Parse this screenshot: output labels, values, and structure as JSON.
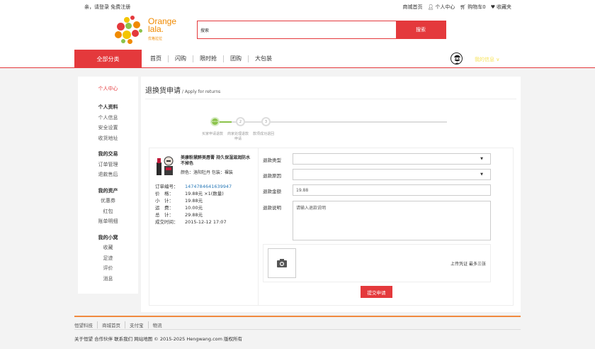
{
  "topbar": {
    "greeting": "亲，请登录 免费注册",
    "links": [
      "商城首页",
      "个人中心",
      "购物车0",
      "收藏夹"
    ]
  },
  "logo": {
    "brand_line1": "Orange",
    "brand_line2": "lala.",
    "sub": "优格拉拉"
  },
  "search": {
    "value": "搜索",
    "button": "搜索"
  },
  "nav": {
    "all_categories": "全部分类",
    "items": [
      "首页",
      "闪购",
      "限时抢",
      "团购",
      "大包装"
    ],
    "username": "我的信息 ∨"
  },
  "sidebar": {
    "center": "个人中心",
    "sections": [
      {
        "title": "个人资料",
        "items": [
          "个人信息",
          "安全设置",
          "收货地址"
        ]
      },
      {
        "title": "我的交易",
        "items": [
          "订单管理",
          "退款售后"
        ]
      },
      {
        "title": "我的资产",
        "items": [
          "优惠券",
          "红包",
          "账单明细"
        ]
      },
      {
        "title": "我的小窝",
        "items": [
          "收藏",
          "足迹",
          "评价",
          "消息"
        ]
      }
    ]
  },
  "page": {
    "title": "退换货申请",
    "subtitle": " / Apply for returns"
  },
  "steps": {
    "numbers": [
      "•••",
      "2",
      "3"
    ],
    "labels": [
      "买家申请退款",
      "商家处理退款申请",
      "款项成功退回"
    ]
  },
  "product": {
    "name": "美康粉黛醉美唇膏 持久保湿滋润防水不掉色",
    "spec": "颜色：洛阳牡丹  包装：裸装"
  },
  "order": {
    "rows": [
      {
        "k": "订单编号：",
        "v": "1474784641639947",
        "link": true
      },
      {
        "k": "价　格：",
        "v": "19.88元 ×1(数量)"
      },
      {
        "k": "小　计：",
        "v": "19.88元"
      },
      {
        "k": "运　费：",
        "v": "10.00元"
      },
      {
        "k": "总　计：",
        "v": "29.88元"
      },
      {
        "k": "成交时间：",
        "v": "2015-12-12 17:07"
      }
    ]
  },
  "form": {
    "type_label": "退款类型",
    "reason_label": "退款原因",
    "amount_label": "退款金额",
    "amount_value": "19.88",
    "desc_label": "退款说明",
    "desc_placeholder": "请输入退款说明",
    "upload_text": "上传凭证 最多三张",
    "submit": "提交申请"
  },
  "footer": {
    "links": [
      "恒望科技",
      "商城首页",
      "支付宝",
      "物流"
    ],
    "copyright": "关于恒望 合作伙伴 联系我们 网站地图 © 2015-2025 Hengwang.com 版权所有"
  },
  "colors": {
    "accent": "#e4393c",
    "brand": "#f08a00",
    "progress": "#8bc34a",
    "link": "#2a7ab8"
  }
}
